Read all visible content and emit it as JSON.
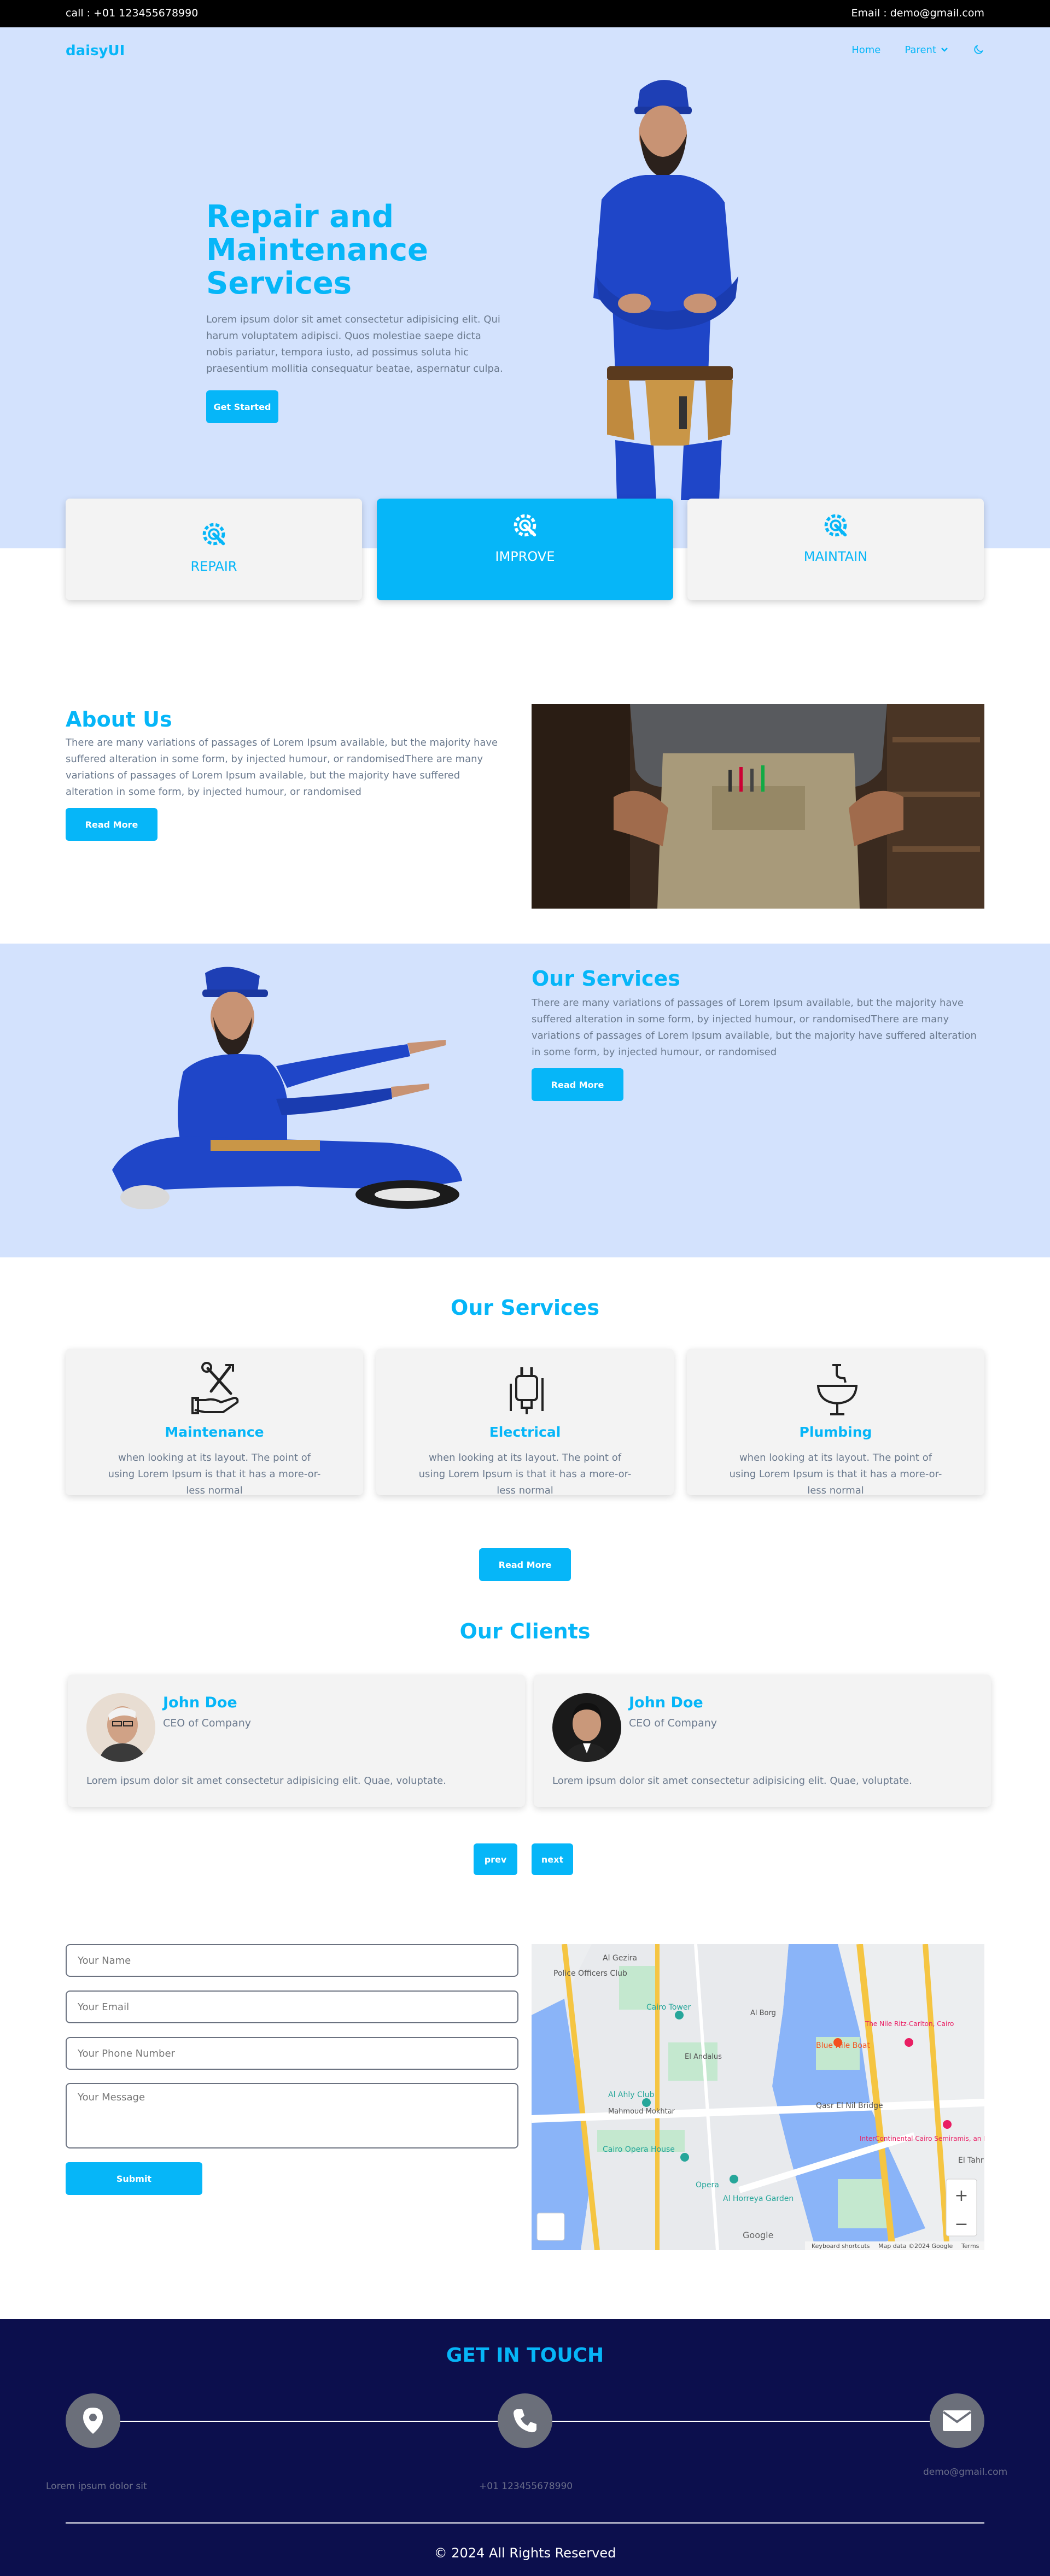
{
  "topbar": {
    "call": "call : +01 123455678990",
    "email": "Email : demo@gmail.com"
  },
  "nav": {
    "brand": "daisyUI",
    "home": "Home",
    "parent": "Parent"
  },
  "hero": {
    "title": "Repair and Maintenance Services",
    "text": "Lorem ipsum dolor sit amet consectetur adipisicing elit. Qui harum voluptatem adipisci. Quos molestiae saepe dicta nobis pariatur, tempora iusto, ad possimus soluta hic praesentium mollitia consequatur beatae, aspernatur culpa.",
    "button": "Get Started"
  },
  "features": [
    {
      "label": "REPAIR"
    },
    {
      "label": "IMPROVE"
    },
    {
      "label": "MAINTAIN"
    }
  ],
  "about": {
    "title": "About Us",
    "text": "There are many variations of passages of Lorem Ipsum available, but the majority have suffered alteration in some form, by injected humour, or randomisedThere are many variations of passages of Lorem Ipsum available, but the majority have suffered alteration in some form, by injected humour, or randomised",
    "button": "Read More"
  },
  "services_intro": {
    "title": "Our Services",
    "text": "There are many variations of passages of Lorem Ipsum available, but the majority have suffered alteration in some form, by injected humour, or randomisedThere are many variations of passages of Lorem Ipsum available, but the majority have suffered alteration in some form, by injected humour, or randomised",
    "button": "Read More"
  },
  "services": {
    "title": "Our Services",
    "items": [
      {
        "title": "Maintenance",
        "text": "when looking at its layout. The point of using Lorem Ipsum is that it has a more-or-less normal"
      },
      {
        "title": "Electrical",
        "text": "when looking at its layout. The point of using Lorem Ipsum is that it has a more-or-less normal"
      },
      {
        "title": "Plumbing",
        "text": "when looking at its layout. The point of using Lorem Ipsum is that it has a more-or-less normal"
      }
    ],
    "button": "Read More"
  },
  "clients": {
    "title": "Our Clients",
    "items": [
      {
        "name": "John Doe",
        "role": "CEO of Company",
        "quote": "Lorem ipsum dolor sit amet consectetur adipisicing elit. Quae, voluptate."
      },
      {
        "name": "John Doe",
        "role": "CEO of Company",
        "quote": "Lorem ipsum dolor sit amet consectetur adipisicing elit. Quae, voluptate."
      }
    ],
    "prev": "prev",
    "next": "next"
  },
  "contact_form": {
    "name_placeholder": "Your Name",
    "email_placeholder": "Your Email",
    "phone_placeholder": "Your Phone Number",
    "message_placeholder": "Your Message",
    "submit": "Submit"
  },
  "map": {
    "labels": [
      "Police Officers Club",
      "Al Gezira",
      "Cairo Tower",
      "Blue Nile Boat",
      "El Tahrir",
      "Al Ahly Club",
      "Mahmoud Mokhtar",
      "Cairo Opera House",
      "Al Horreya Garden",
      "Qasr El Nil Bridge",
      "InterContinental Cairo Semiramis, an IHG",
      "The Nile Ritz-Carlton, Cairo",
      "El Andalus",
      "Al Borg",
      "Opera"
    ],
    "attribution": "Google",
    "footer_links": [
      "Keyboard shortcuts",
      "Map data ©2024 Google",
      "Terms"
    ]
  },
  "footer": {
    "title": "GET IN TOUCH",
    "address": "Lorem ipsum dolor sit",
    "phone": "+01 123455678990",
    "email": "demo@gmail.com",
    "copyright": "© 2024 All Rights Reserved"
  },
  "colors": {
    "accent": "#06b6f8",
    "hero_bg": "#d3e2fd",
    "footer_bg": "#0c0f4d"
  }
}
